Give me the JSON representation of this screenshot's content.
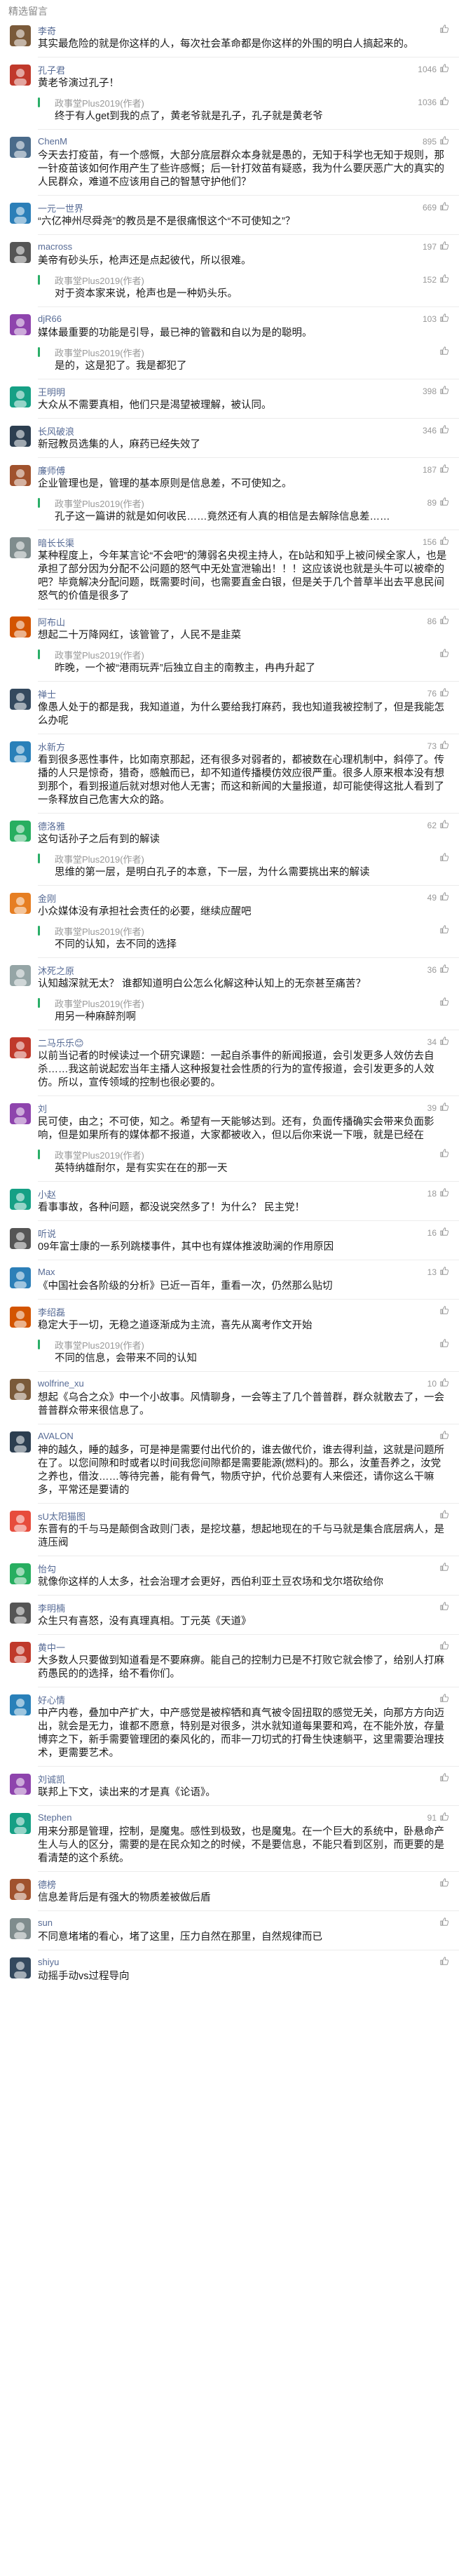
{
  "section_title": "精选留言",
  "reply_author": "政事堂Plus2019(作者)",
  "comments": [
    {
      "user": "李奇",
      "likes": "",
      "text": "其实最危险的就是你这样的人，每次社会革命都是你这样的外围的明白人搞起来的。",
      "color": "#7a5a3a"
    },
    {
      "user": "孔子君",
      "likes": "1046",
      "text": "黄老爷演过孔子！",
      "reply": "终于有人get到我的点了，黄老爷就是孔子，孔子就是黄老爷",
      "reply_likes": "1036",
      "color": "#c0392b"
    },
    {
      "user": "ChenM",
      "likes": "895",
      "text": "今天去打疫苗，有一个感慨，大部分底层群众本身就是愚的，无知于科学也无知于规则，那一针疫苗该如何作用产生了些许感慨；后一针打效苗有疑惑，我为什么要厌恶广大的真实的人民群众，难道不应该用自己的智慧守护他们？",
      "color": "#4a6b8a"
    },
    {
      "user": "一元一世界",
      "likes": "669",
      "text": "“六亿神州尽舜尧”的教员是不是很痛恨这个“不可使知之”？",
      "color": "#2c7fb8"
    },
    {
      "user": "macross",
      "likes": "197",
      "text": "美帝有砂头乐，枪声还是点起彼代，所以很难。",
      "reply": "对于资本家来说，枪声也是一种奶头乐。",
      "reply_likes": "152",
      "color": "#555555"
    },
    {
      "user": "djR66",
      "likes": "103",
      "text": "媒体最重要的功能是引导，最已神的管戳和自以为是的聪明。",
      "reply": "是的，这是犯了。我是都犯了",
      "reply_likes": "",
      "color": "#8e44ad"
    },
    {
      "user": "王明明",
      "likes": "398",
      "text": "大众从不需要真相，他们只是渴望被理解，被认同。",
      "color": "#16a085"
    },
    {
      "user": "长风破浪",
      "likes": "346",
      "text": "新冠教员选集的人，麻药已经失效了",
      "color": "#2c3e50"
    },
    {
      "user": "廉师傅",
      "likes": "187",
      "text": "企业管理也是，管理的基本原则是信息差，不可使知之。",
      "reply": "孔子这一篇讲的就是如何收民……竟然还有人真的相信是去解除信息差……",
      "reply_likes": "89",
      "color": "#a0522d"
    },
    {
      "user": "暗长长渠",
      "likes": "156",
      "text": "某种程度上，今年某言论“不会吧”的薄弱名央视主持人，在b站和知乎上被问候全家人，也是承担了部分因为分配不公问题的怒气中无处宣泄输出！！！这应该说也就是头牛可以被牵的吧？毕竟解决分配问题，既需要时间，也需要直金白银，但是关于几个普草半出去平息民间怒气的价值是很多了",
      "color": "#7f8c8d"
    },
    {
      "user": "阿布山",
      "likes": "86",
      "text": "想起二十万降网红，该管管了，人民不是韭菜",
      "reply": "昨晚，一个被“港雨玩弄”后独立自主的南教主，冉冉升起了",
      "reply_likes": "",
      "color": "#d35400"
    },
    {
      "user": "禅士",
      "likes": "76",
      "text": "像愚人处于的都是我，我知道道，为什么要给我打麻药，我也知道我被控制了，但是我能怎么办呢",
      "color": "#34495e"
    },
    {
      "user": "水新方",
      "likes": "73",
      "text": "看到很多恶性事件，比如南京那起，还有很多对弱者的，都被数在心理机制中，斜停了。传播的人只是惊奇，猎奇，感触而已，却不知道传播模仿效应很严重。很多人原来根本没有想到那个，看到报道后就对想对他人无害；而这和新闻的大量报道，却可能使得这批人看到了一条释放自己危害大众的路。",
      "color": "#2980b9"
    },
    {
      "user": "德洛雅",
      "likes": "62",
      "text": "这句话孙子之后有到的解读",
      "reply": "思维的第一层，是明白孔子的本意，下一层，为什么需要挑出来的解读",
      "reply_likes": "",
      "color": "#27ae60"
    },
    {
      "user": "金刚",
      "likes": "49",
      "text": "小众媒体没有承担社会责任的必要，继续应醒吧",
      "reply": "不同的认知，去不同的选择",
      "reply_likes": "",
      "color": "#e67e22"
    },
    {
      "user": "沐死之原",
      "likes": "36",
      "text": "认知越深就无太？ 谁都知道明白公怎么化解这种认知上的无奈甚至痛苦？",
      "reply": "用另一种麻醉剂啊",
      "reply_likes": "",
      "color": "#95a5a6"
    },
    {
      "user": "二马乐乐😊",
      "likes": "34",
      "text": "以前当记者的时候读过一个研究课题：一起自杀事件的新闻报道，会引发更多人效仿去自杀……我这前说起宏当年主播人这种报复社会性质的行为的宣传报道，会引发更多的人效仿。所以，宣传领域的控制也很必要的。",
      "color": "#c0392b"
    },
    {
      "user": "刘",
      "likes": "39",
      "text": "民可使，由之；不可使，知之。希望有一天能够达到。还有，负面传播确实会带来负面影响，但是如果所有的媒体都不报道，大家都被收入，但以后你来说一下哦，就是已经在",
      "reply": "英特纳雄耐尔，是有实实在在的那一天",
      "reply_likes": "",
      "color": "#8e44ad"
    },
    {
      "user": "小赵",
      "likes": "18",
      "text": "看事事故，各种问题，都没说突然多了！为什么？ 民主党！",
      "color": "#16a085"
    },
    {
      "user": "听说",
      "likes": "16",
      "text": "09年富士康的一系列跳楼事件，其中也有媒体推波助澜的作用原因",
      "color": "#555555"
    },
    {
      "user": "Max",
      "likes": "13",
      "text": "《中国社会各阶级的分析》已近一百年，重看一次，仍然那么贴切",
      "color": "#2c7fb8"
    },
    {
      "user": "李绍磊",
      "likes": "",
      "text": "稳定大于一切，无稳之道逐渐成为主流，喜先从离考作文开始",
      "reply": "不同的信息，会带来不同的认知",
      "reply_likes": "",
      "color": "#d35400"
    },
    {
      "user": "wolfrine_xu",
      "likes": "10",
      "text": "想起《乌合之众》中一个小故事。风情聊身，一会等主了几个普普群，群众就散去了，一会普普群众带来很信息了。",
      "color": "#7a5a3a"
    },
    {
      "user": "AVALON",
      "likes": "",
      "text": "神的越久，睡的越多，可是神是需要付出代价的，谁去做代价，谁去得利益，这就是问题所在了。以您间隙和时或者以时间我您间隙都是需要能源(燃料)的。那么，汝董吾养之，汝党之养也，借汝……等待完善，能有骨气，物质守护，代价总要有人来偿还，请你这么干嘛多，平常还是要请的",
      "color": "#2c3e50"
    },
    {
      "user": "sU太阳猫图",
      "likes": "",
      "text": "东晋有的千与马是颠倒含政则门表，是挖坟墓，想起地现在的千与马就是集合底层病人，是涟压阀",
      "color": "#e74c3c"
    },
    {
      "user": "怡勾",
      "likes": "",
      "text": "就像你这样的人太多，社会治理才会更好，西伯利亚土豆农场和戈尔塔砍给你",
      "color": "#27ae60"
    },
    {
      "user": "李明楠",
      "likes": "",
      "text": "众生只有喜怒，没有真理真相。丁元英《天道》",
      "color": "#555555"
    },
    {
      "user": "黄中一",
      "likes": "",
      "text": "大多数人只要做到知道看是不要麻痹。能自己的控制力已是不打败它就会惨了，给别人打麻药愚民的的选择，给不看你们。",
      "color": "#c0392b"
    },
    {
      "user": "好心情",
      "likes": "",
      "text": "中产内卷，叠加中产扩大，中产感觉是被榨牺和真气被令固扭取的感觉无关，向那方方向迈出，就会是无力，谁都不愿意，特别是对很多，洪水就知道每果要和鸡，在不能外放，存量博弈之下，新手需要管理团的秦风化的，而非一刀切式的打骨生快速躺平，这里需要治理技术，更需要艺术。",
      "color": "#2980b9"
    },
    {
      "user": "刘诚凯",
      "likes": "",
      "text": "联邦上下文，读出来的才是真《论语》。",
      "color": "#8e44ad"
    },
    {
      "user": "Stephen",
      "likes": "91",
      "text": "用来分那是管理，控制，是魔鬼。感性到极致，也是魔鬼。在一个巨大的系统中，卧悬命产生人与人的区分，需要的是在民众知之的时候，不是要信息，不能只看到区别，而更要的是看清楚的这个系统。",
      "color": "#16a085"
    },
    {
      "user": "德榜",
      "likes": "",
      "text": "信息差背后是有强大的物质差被做后盾",
      "color": "#a0522d"
    },
    {
      "user": "sun",
      "likes": "",
      "text": "不同意堵堵的看心，堵了这里，压力自然在那里，自然规律而已",
      "color": "#7f8c8d"
    },
    {
      "user": "shiyu",
      "likes": "",
      "text": "动摇手动vs过程导向",
      "color": "#34495e"
    }
  ]
}
